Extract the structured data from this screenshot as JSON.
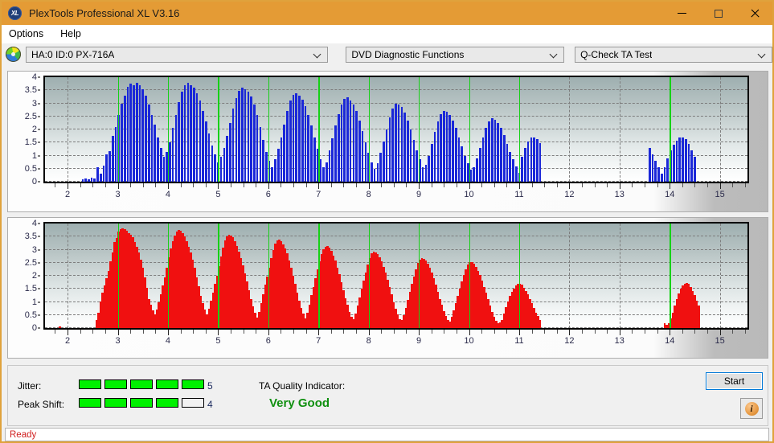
{
  "window": {
    "title": "PlexTools Professional XL V3.16",
    "app_icon": "xl-logo-icon",
    "minimize_label": "—",
    "maximize_label": "□",
    "close_label": "✕"
  },
  "menu": {
    "items": [
      {
        "label": "Options"
      },
      {
        "label": "Help"
      }
    ]
  },
  "toolbar": {
    "drive_icon": "optical-disc-icon",
    "drive": "HA:0 ID:0  PX-716A",
    "function": "DVD Diagnostic Functions",
    "test": "Q-Check TA Test"
  },
  "results": {
    "jitter_label": "Jitter:",
    "jitter_value": "5",
    "jitter_filled": 5,
    "jitter_total": 5,
    "peak_shift_label": "Peak Shift:",
    "peak_shift_value": "4",
    "peak_shift_filled": 4,
    "peak_shift_total": 5,
    "ta_quality_label": "TA Quality Indicator:",
    "ta_quality_value": "Very Good",
    "ta_quality_color": "#109010",
    "start_label": "Start",
    "info_label": "i",
    "meter_on_color": "#00f100"
  },
  "status": {
    "text": "Ready",
    "color": "#d02020"
  },
  "chart_data": [
    {
      "type": "bar",
      "name": "jitter-chart",
      "title": "",
      "xlabel": "",
      "ylabel": "",
      "color": "#1a27d8",
      "xlim": [
        1.55,
        15.55
      ],
      "ylim": [
        0,
        4
      ],
      "yticks": [
        0,
        0.5,
        1,
        1.5,
        2,
        2.5,
        3,
        3.5,
        4
      ],
      "ytick_labels": [
        "0",
        "0.5",
        "1",
        "1.5",
        "2",
        "2.5",
        "3",
        "3.5",
        "4"
      ],
      "xticks": [
        2,
        3,
        4,
        5,
        6,
        7,
        8,
        9,
        10,
        11,
        12,
        13,
        14,
        15
      ],
      "xtick_labels": [
        "2",
        "3",
        "4",
        "5",
        "6",
        "7",
        "8",
        "9",
        "10",
        "11",
        "12",
        "13",
        "14",
        "15"
      ],
      "grid": true,
      "marker_lines": [
        3,
        4,
        5,
        6,
        7,
        8,
        9,
        10,
        11,
        14
      ],
      "marker_color": "#16d116",
      "bar_x": [
        2.3,
        2.36,
        2.42,
        2.48,
        2.54,
        2.6,
        2.66,
        2.72,
        2.78,
        2.84,
        2.9,
        2.96,
        3.02,
        3.08,
        3.14,
        3.2,
        3.26,
        3.32,
        3.38,
        3.44,
        3.5,
        3.56,
        3.62,
        3.68,
        3.74,
        3.8,
        3.86,
        3.92,
        3.98,
        4.04,
        4.1,
        4.16,
        4.22,
        4.28,
        4.34,
        4.4,
        4.46,
        4.52,
        4.58,
        4.64,
        4.7,
        4.76,
        4.82,
        4.88,
        4.94,
        5.0,
        5.06,
        5.12,
        5.18,
        5.24,
        5.3,
        5.36,
        5.42,
        5.48,
        5.54,
        5.6,
        5.66,
        5.72,
        5.78,
        5.84,
        5.9,
        5.96,
        6.02,
        6.08,
        6.14,
        6.2,
        6.26,
        6.32,
        6.38,
        6.44,
        6.5,
        6.56,
        6.62,
        6.68,
        6.74,
        6.8,
        6.86,
        6.92,
        6.98,
        7.04,
        7.1,
        7.16,
        7.22,
        7.28,
        7.34,
        7.4,
        7.46,
        7.52,
        7.58,
        7.64,
        7.7,
        7.76,
        7.82,
        7.88,
        7.94,
        8.0,
        8.06,
        8.12,
        8.18,
        8.24,
        8.3,
        8.36,
        8.42,
        8.48,
        8.54,
        8.6,
        8.66,
        8.72,
        8.78,
        8.84,
        8.9,
        8.96,
        9.02,
        9.08,
        9.14,
        9.2,
        9.26,
        9.32,
        9.38,
        9.44,
        9.5,
        9.56,
        9.62,
        9.68,
        9.74,
        9.8,
        9.86,
        9.92,
        9.98,
        10.04,
        10.1,
        10.16,
        10.22,
        10.28,
        10.34,
        10.4,
        10.46,
        10.52,
        10.58,
        10.64,
        10.7,
        10.76,
        10.82,
        10.88,
        10.94,
        11.0,
        11.06,
        11.12,
        11.18,
        11.24,
        11.3,
        11.36,
        11.42,
        13.6,
        13.66,
        13.72,
        13.78,
        13.84,
        13.9,
        13.96,
        14.02,
        14.08,
        14.14,
        14.2,
        14.26,
        14.32,
        14.38,
        14.44,
        14.5
      ],
      "bar_y": [
        0.1,
        0.12,
        0.08,
        0.15,
        0.12,
        0.55,
        0.3,
        0.62,
        1.05,
        1.18,
        1.75,
        2.1,
        2.55,
        3.0,
        3.3,
        3.62,
        3.75,
        3.7,
        3.78,
        3.7,
        3.55,
        3.3,
        2.95,
        2.55,
        2.2,
        1.7,
        1.3,
        0.95,
        1.15,
        1.5,
        2.05,
        2.55,
        3.05,
        3.45,
        3.7,
        3.78,
        3.68,
        3.6,
        3.4,
        3.1,
        2.7,
        2.3,
        1.85,
        1.4,
        1.05,
        0.75,
        0.95,
        1.3,
        1.75,
        2.25,
        2.8,
        3.2,
        3.48,
        3.6,
        3.55,
        3.45,
        3.25,
        2.95,
        2.55,
        2.1,
        1.6,
        1.15,
        0.8,
        0.55,
        0.85,
        1.25,
        1.7,
        2.2,
        2.7,
        3.1,
        3.32,
        3.4,
        3.3,
        3.15,
        2.9,
        2.55,
        2.15,
        1.7,
        1.25,
        0.85,
        0.55,
        0.75,
        1.2,
        1.65,
        2.15,
        2.6,
        2.95,
        3.18,
        3.22,
        3.12,
        2.95,
        2.7,
        2.35,
        1.95,
        1.5,
        1.1,
        0.75,
        0.5,
        0.7,
        1.1,
        1.55,
        2.0,
        2.45,
        2.8,
        2.98,
        2.95,
        2.85,
        2.65,
        2.35,
        2.0,
        1.6,
        1.2,
        0.85,
        0.55,
        0.65,
        1.0,
        1.45,
        1.9,
        2.3,
        2.6,
        2.72,
        2.68,
        2.55,
        2.35,
        2.05,
        1.7,
        1.35,
        1.0,
        0.7,
        0.45,
        0.55,
        0.9,
        1.3,
        1.7,
        2.05,
        2.32,
        2.42,
        2.38,
        2.25,
        2.05,
        1.78,
        1.45,
        1.15,
        0.85,
        0.58,
        0.35,
        0.95,
        1.3,
        1.55,
        1.68,
        1.7,
        1.62,
        1.48,
        1.28,
        1.05,
        0.8,
        0.55,
        0.32,
        0.55,
        0.9,
        1.2,
        1.42,
        1.58,
        1.68,
        1.7,
        1.62,
        1.45,
        1.2,
        0.95,
        0.68,
        0.4,
        0.2,
        0.1
      ]
    },
    {
      "type": "bar",
      "name": "peak-shift-chart",
      "title": "",
      "xlabel": "",
      "ylabel": "",
      "color": "#f01010",
      "xlim": [
        1.55,
        15.55
      ],
      "ylim": [
        0,
        4
      ],
      "yticks": [
        0,
        0.5,
        1,
        1.5,
        2,
        2.5,
        3,
        3.5,
        4
      ],
      "ytick_labels": [
        "0",
        "0.5",
        "1",
        "1.5",
        "2",
        "2.5",
        "3",
        "3.5",
        "4"
      ],
      "xticks": [
        2,
        3,
        4,
        5,
        6,
        7,
        8,
        9,
        10,
        11,
        12,
        13,
        14,
        15
      ],
      "xtick_labels": [
        "2",
        "3",
        "4",
        "5",
        "6",
        "7",
        "8",
        "9",
        "10",
        "11",
        "12",
        "13",
        "14",
        "15"
      ],
      "grid": true,
      "marker_lines": [
        3,
        4,
        5,
        6,
        7,
        8,
        9,
        10,
        11,
        14
      ],
      "marker_color": "#16d116",
      "bar_x": [
        1.85,
        2.58,
        2.62,
        2.66,
        2.7,
        2.74,
        2.78,
        2.82,
        2.86,
        2.9,
        2.94,
        2.98,
        3.02,
        3.06,
        3.1,
        3.14,
        3.18,
        3.22,
        3.26,
        3.3,
        3.34,
        3.38,
        3.42,
        3.46,
        3.5,
        3.54,
        3.58,
        3.62,
        3.66,
        3.7,
        3.74,
        3.78,
        3.82,
        3.86,
        3.9,
        3.94,
        3.98,
        4.02,
        4.06,
        4.1,
        4.14,
        4.18,
        4.22,
        4.26,
        4.3,
        4.34,
        4.38,
        4.42,
        4.46,
        4.5,
        4.54,
        4.58,
        4.62,
        4.66,
        4.7,
        4.74,
        4.78,
        4.82,
        4.86,
        4.9,
        4.94,
        4.98,
        5.02,
        5.06,
        5.1,
        5.14,
        5.18,
        5.22,
        5.26,
        5.3,
        5.34,
        5.38,
        5.42,
        5.46,
        5.5,
        5.54,
        5.58,
        5.62,
        5.66,
        5.7,
        5.74,
        5.78,
        5.82,
        5.86,
        5.9,
        5.94,
        5.98,
        6.02,
        6.06,
        6.1,
        6.14,
        6.18,
        6.22,
        6.26,
        6.3,
        6.34,
        6.38,
        6.42,
        6.46,
        6.5,
        6.54,
        6.58,
        6.62,
        6.66,
        6.7,
        6.74,
        6.78,
        6.82,
        6.86,
        6.9,
        6.94,
        6.98,
        7.02,
        7.06,
        7.1,
        7.14,
        7.18,
        7.22,
        7.26,
        7.3,
        7.34,
        7.38,
        7.42,
        7.46,
        7.5,
        7.54,
        7.58,
        7.62,
        7.66,
        7.7,
        7.74,
        7.78,
        7.82,
        7.86,
        7.9,
        7.94,
        7.98,
        8.02,
        8.06,
        8.1,
        8.14,
        8.18,
        8.22,
        8.26,
        8.3,
        8.34,
        8.38,
        8.42,
        8.46,
        8.5,
        8.54,
        8.58,
        8.62,
        8.66,
        8.7,
        8.74,
        8.78,
        8.82,
        8.86,
        8.9,
        8.94,
        8.98,
        9.02,
        9.06,
        9.1,
        9.14,
        9.18,
        9.22,
        9.26,
        9.3,
        9.34,
        9.38,
        9.42,
        9.46,
        9.5,
        9.54,
        9.58,
        9.62,
        9.66,
        9.7,
        9.74,
        9.78,
        9.82,
        9.86,
        9.9,
        9.94,
        9.98,
        10.02,
        10.06,
        10.1,
        10.14,
        10.18,
        10.22,
        10.26,
        10.3,
        10.34,
        10.38,
        10.42,
        10.46,
        10.5,
        10.54,
        10.58,
        10.62,
        10.66,
        10.7,
        10.74,
        10.78,
        10.82,
        10.86,
        10.9,
        10.94,
        10.98,
        11.02,
        11.06,
        11.1,
        11.14,
        11.18,
        11.22,
        11.26,
        11.3,
        11.34,
        11.38,
        11.42,
        13.9,
        13.94,
        13.98,
        14.02,
        14.06,
        14.1,
        14.14,
        14.18,
        14.22,
        14.26,
        14.3,
        14.34,
        14.38,
        14.42,
        14.46,
        14.5,
        14.54,
        14.58
      ],
      "bar_y": [
        0.06,
        0.32,
        0.6,
        1.02,
        1.35,
        1.62,
        1.9,
        2.2,
        2.55,
        2.88,
        3.28,
        3.45,
        3.68,
        3.78,
        3.82,
        3.8,
        3.72,
        3.62,
        3.58,
        3.48,
        3.3,
        3.12,
        2.88,
        2.62,
        2.3,
        1.95,
        1.55,
        1.1,
        0.9,
        0.68,
        0.52,
        0.72,
        1.0,
        1.3,
        1.62,
        1.95,
        2.32,
        2.7,
        3.05,
        3.32,
        3.55,
        3.68,
        3.75,
        3.72,
        3.62,
        3.5,
        3.32,
        3.12,
        2.88,
        2.62,
        2.3,
        1.95,
        1.6,
        1.22,
        0.95,
        0.72,
        0.52,
        0.75,
        1.05,
        1.35,
        1.68,
        2.0,
        2.38,
        2.75,
        3.08,
        3.35,
        3.52,
        3.58,
        3.55,
        3.48,
        3.32,
        3.15,
        2.92,
        2.68,
        2.4,
        2.08,
        1.78,
        1.45,
        1.1,
        0.82,
        0.58,
        0.4,
        0.62,
        0.95,
        1.3,
        1.65,
        1.98,
        2.32,
        2.68,
        3.0,
        3.22,
        3.35,
        3.38,
        3.32,
        3.2,
        3.05,
        2.85,
        2.6,
        2.32,
        2.0,
        1.68,
        1.35,
        1.05,
        0.78,
        0.55,
        0.38,
        0.58,
        0.9,
        1.25,
        1.58,
        1.92,
        2.25,
        2.55,
        2.82,
        3.02,
        3.12,
        3.15,
        3.08,
        2.95,
        2.78,
        2.58,
        2.32,
        2.05,
        1.75,
        1.45,
        1.15,
        0.88,
        0.62,
        0.42,
        0.35,
        0.55,
        0.85,
        1.18,
        1.5,
        1.82,
        2.12,
        2.42,
        2.68,
        2.85,
        2.92,
        2.9,
        2.82,
        2.7,
        2.55,
        2.35,
        2.12,
        1.85,
        1.58,
        1.28,
        1.0,
        0.75,
        0.52,
        0.35,
        0.3,
        0.48,
        0.78,
        1.08,
        1.38,
        1.68,
        1.98,
        2.25,
        2.48,
        2.62,
        2.68,
        2.65,
        2.58,
        2.45,
        2.3,
        2.12,
        1.9,
        1.65,
        1.4,
        1.12,
        0.88,
        0.65,
        0.45,
        0.3,
        0.25,
        0.42,
        0.68,
        0.95,
        1.22,
        1.5,
        1.78,
        2.02,
        2.25,
        2.42,
        2.52,
        2.52,
        2.45,
        2.35,
        2.2,
        2.02,
        1.82,
        1.58,
        1.35,
        1.1,
        0.85,
        0.62,
        0.42,
        0.28,
        0.18,
        0.22,
        0.3,
        0.55,
        0.8,
        1.02,
        1.22,
        1.38,
        1.52,
        1.62,
        1.68,
        1.7,
        1.65,
        1.55,
        1.42,
        1.28,
        1.12,
        0.95,
        0.78,
        0.6,
        0.45,
        0.32,
        0.2,
        0.12,
        0.2,
        0.38,
        0.6,
        0.85,
        1.1,
        1.32,
        1.5,
        1.62,
        1.7,
        1.72,
        1.68,
        1.58,
        1.42,
        1.25,
        1.05,
        0.85,
        0.65,
        0.45,
        0.28,
        0.15,
        0.1
      ]
    }
  ]
}
